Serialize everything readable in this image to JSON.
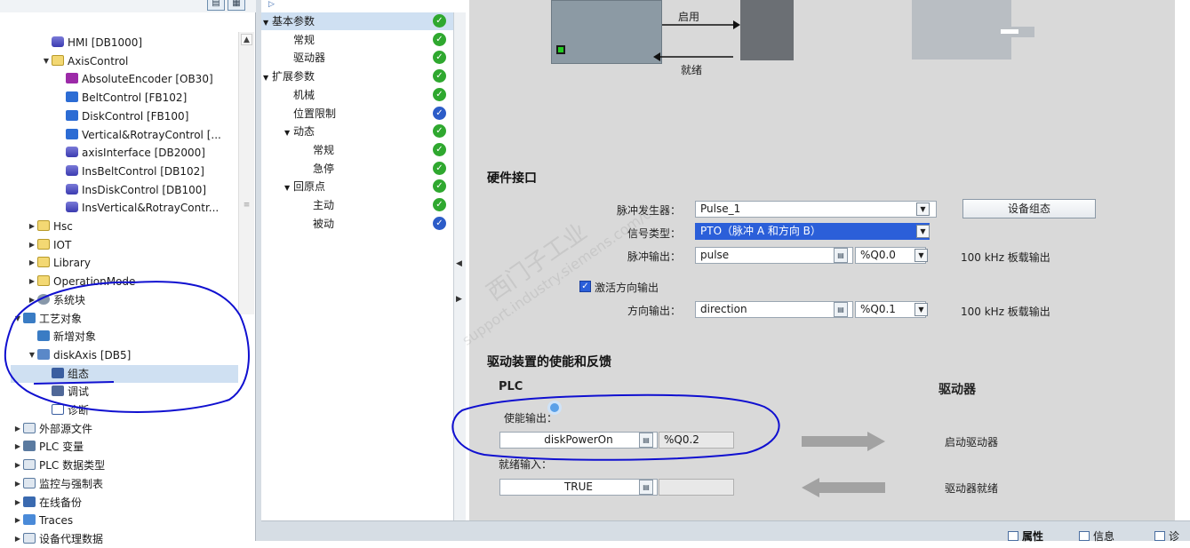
{
  "project_tree": {
    "items": [
      {
        "label": "HMI [DB1000]",
        "icon": "db-icon",
        "arrow": "",
        "indent": 2
      },
      {
        "label": "AxisControl",
        "icon": "folder-icon",
        "arrow": "▼",
        "indent": 2
      },
      {
        "label": "AbsoluteEncoder [OB30]",
        "icon": "ob-icon",
        "arrow": "",
        "indent": 3
      },
      {
        "label": "BeltControl [FB102]",
        "icon": "fb-icon",
        "arrow": "",
        "indent": 3
      },
      {
        "label": "DiskControl [FB100]",
        "icon": "fb-icon",
        "arrow": "",
        "indent": 3
      },
      {
        "label": "Vertical&RotrayControl [...",
        "icon": "fb-icon",
        "arrow": "",
        "indent": 3
      },
      {
        "label": "axisInterface [DB2000]",
        "icon": "db-icon",
        "arrow": "",
        "indent": 3
      },
      {
        "label": "InsBeltControl [DB102]",
        "icon": "db-icon",
        "arrow": "",
        "indent": 3
      },
      {
        "label": "InsDiskControl [DB100]",
        "icon": "db-icon",
        "arrow": "",
        "indent": 3
      },
      {
        "label": "InsVertical&RotrayContr...",
        "icon": "db-icon",
        "arrow": "",
        "indent": 3
      },
      {
        "label": "Hsc",
        "icon": "folder-icon",
        "arrow": "▶",
        "indent": 1
      },
      {
        "label": "IOT",
        "icon": "folder-icon",
        "arrow": "▶",
        "indent": 1
      },
      {
        "label": "Library",
        "icon": "folder-icon",
        "arrow": "▶",
        "indent": 1
      },
      {
        "label": "OperationMode",
        "icon": "folder-icon",
        "arrow": "▶",
        "indent": 1
      },
      {
        "label": "系统块",
        "icon": "gear-icon",
        "arrow": "▶",
        "indent": 1
      },
      {
        "label": "工艺对象",
        "icon": "technology-object-icon",
        "arrow": "▼",
        "indent": 0
      },
      {
        "label": "新增对象",
        "icon": "add-object-icon",
        "arrow": "",
        "indent": 1
      },
      {
        "label": "diskAxis [DB5]",
        "icon": "axis-icon",
        "arrow": "▼",
        "indent": 1
      },
      {
        "label": "组态",
        "icon": "configuration-icon",
        "arrow": "",
        "indent": 2,
        "selected": true
      },
      {
        "label": "调试",
        "icon": "commissioning-icon",
        "arrow": "",
        "indent": 2
      },
      {
        "label": "诊断",
        "icon": "diagnostics-icon",
        "arrow": "",
        "indent": 2
      },
      {
        "label": "外部源文件",
        "icon": "external-source-icon",
        "arrow": "▶",
        "indent": 0
      },
      {
        "label": "PLC 变量",
        "icon": "plc-tags-icon",
        "arrow": "▶",
        "indent": 0
      },
      {
        "label": "PLC 数据类型",
        "icon": "plc-datatype-icon",
        "arrow": "▶",
        "indent": 0
      },
      {
        "label": "监控与强制表",
        "icon": "watch-table-icon",
        "arrow": "▶",
        "indent": 0
      },
      {
        "label": "在线备份",
        "icon": "online-backup-icon",
        "arrow": "▶",
        "indent": 0
      },
      {
        "label": "Traces",
        "icon": "traces-icon",
        "arrow": "▶",
        "indent": 0
      },
      {
        "label": "设备代理数据",
        "icon": "device-proxy-icon",
        "arrow": "▶",
        "indent": 0
      }
    ]
  },
  "config_nav": {
    "items": [
      {
        "label": "基本参数",
        "arrow": "▼",
        "level": 0,
        "status": "ok",
        "selected": true
      },
      {
        "label": "常规",
        "arrow": "",
        "level": 1,
        "status": "ok"
      },
      {
        "label": "驱动器",
        "arrow": "",
        "level": 1,
        "status": "ok"
      },
      {
        "label": "扩展参数",
        "arrow": "▼",
        "level": 0,
        "status": "ok"
      },
      {
        "label": "机械",
        "arrow": "",
        "level": 1,
        "status": "ok"
      },
      {
        "label": "位置限制",
        "arrow": "",
        "level": 1,
        "status": "info"
      },
      {
        "label": "动态",
        "arrow": "▼",
        "level": 1,
        "status": "ok"
      },
      {
        "label": "常规",
        "arrow": "",
        "level": 2,
        "status": "ok"
      },
      {
        "label": "急停",
        "arrow": "",
        "level": 2,
        "status": "ok"
      },
      {
        "label": "回原点",
        "arrow": "▼",
        "level": 1,
        "status": "ok"
      },
      {
        "label": "主动",
        "arrow": "",
        "level": 2,
        "status": "ok"
      },
      {
        "label": "被动",
        "arrow": "",
        "level": 2,
        "status": "info"
      }
    ]
  },
  "diagram": {
    "enable_label": "启用",
    "ready_label": "就绪"
  },
  "hardware_interface": {
    "title": "硬件接口",
    "pulse_generator_label": "脉冲发生器：",
    "pulse_generator_value": "Pulse_1",
    "device_config_button": "设备组态",
    "signal_type_label": "信号类型：",
    "signal_type_value": "PTO（脉冲 A 和方向 B）",
    "pulse_output_label": "脉冲输出：",
    "pulse_output_value": "pulse",
    "pulse_output_address": "%Q0.0",
    "pulse_output_note": "100 kHz 板载输出",
    "enable_direction_label": "激活方向输出",
    "enable_direction_checked": true,
    "direction_output_label": "方向输出：",
    "direction_output_value": "direction",
    "direction_output_address": "%Q0.1",
    "direction_output_note": "100 kHz 板载输出"
  },
  "drive_enable": {
    "title": "驱动装置的使能和反馈",
    "plc_header": "PLC",
    "drive_header": "驱动器",
    "enable_output_label": "使能输出：",
    "enable_output_value": "diskPowerOn",
    "enable_output_address": "%Q0.2",
    "enable_drive_label": "启动驱动器",
    "ready_input_label": "就绪输入：",
    "ready_input_value": "TRUE",
    "ready_input_address": "",
    "drive_ready_label": "驱动器就绪"
  },
  "bottom_tabs": {
    "properties": "属性",
    "info": "信息",
    "diagnostics": "诊"
  },
  "watermark": {
    "line1": "西门子工业",
    "line2": "support.industry.siemens.com/cs"
  },
  "colors": {
    "ok": "#2fa82f",
    "info": "#2c5cc8",
    "selection": "#cfe0f2",
    "annotation": "#1010d0",
    "panel": "#d9d9d9"
  }
}
